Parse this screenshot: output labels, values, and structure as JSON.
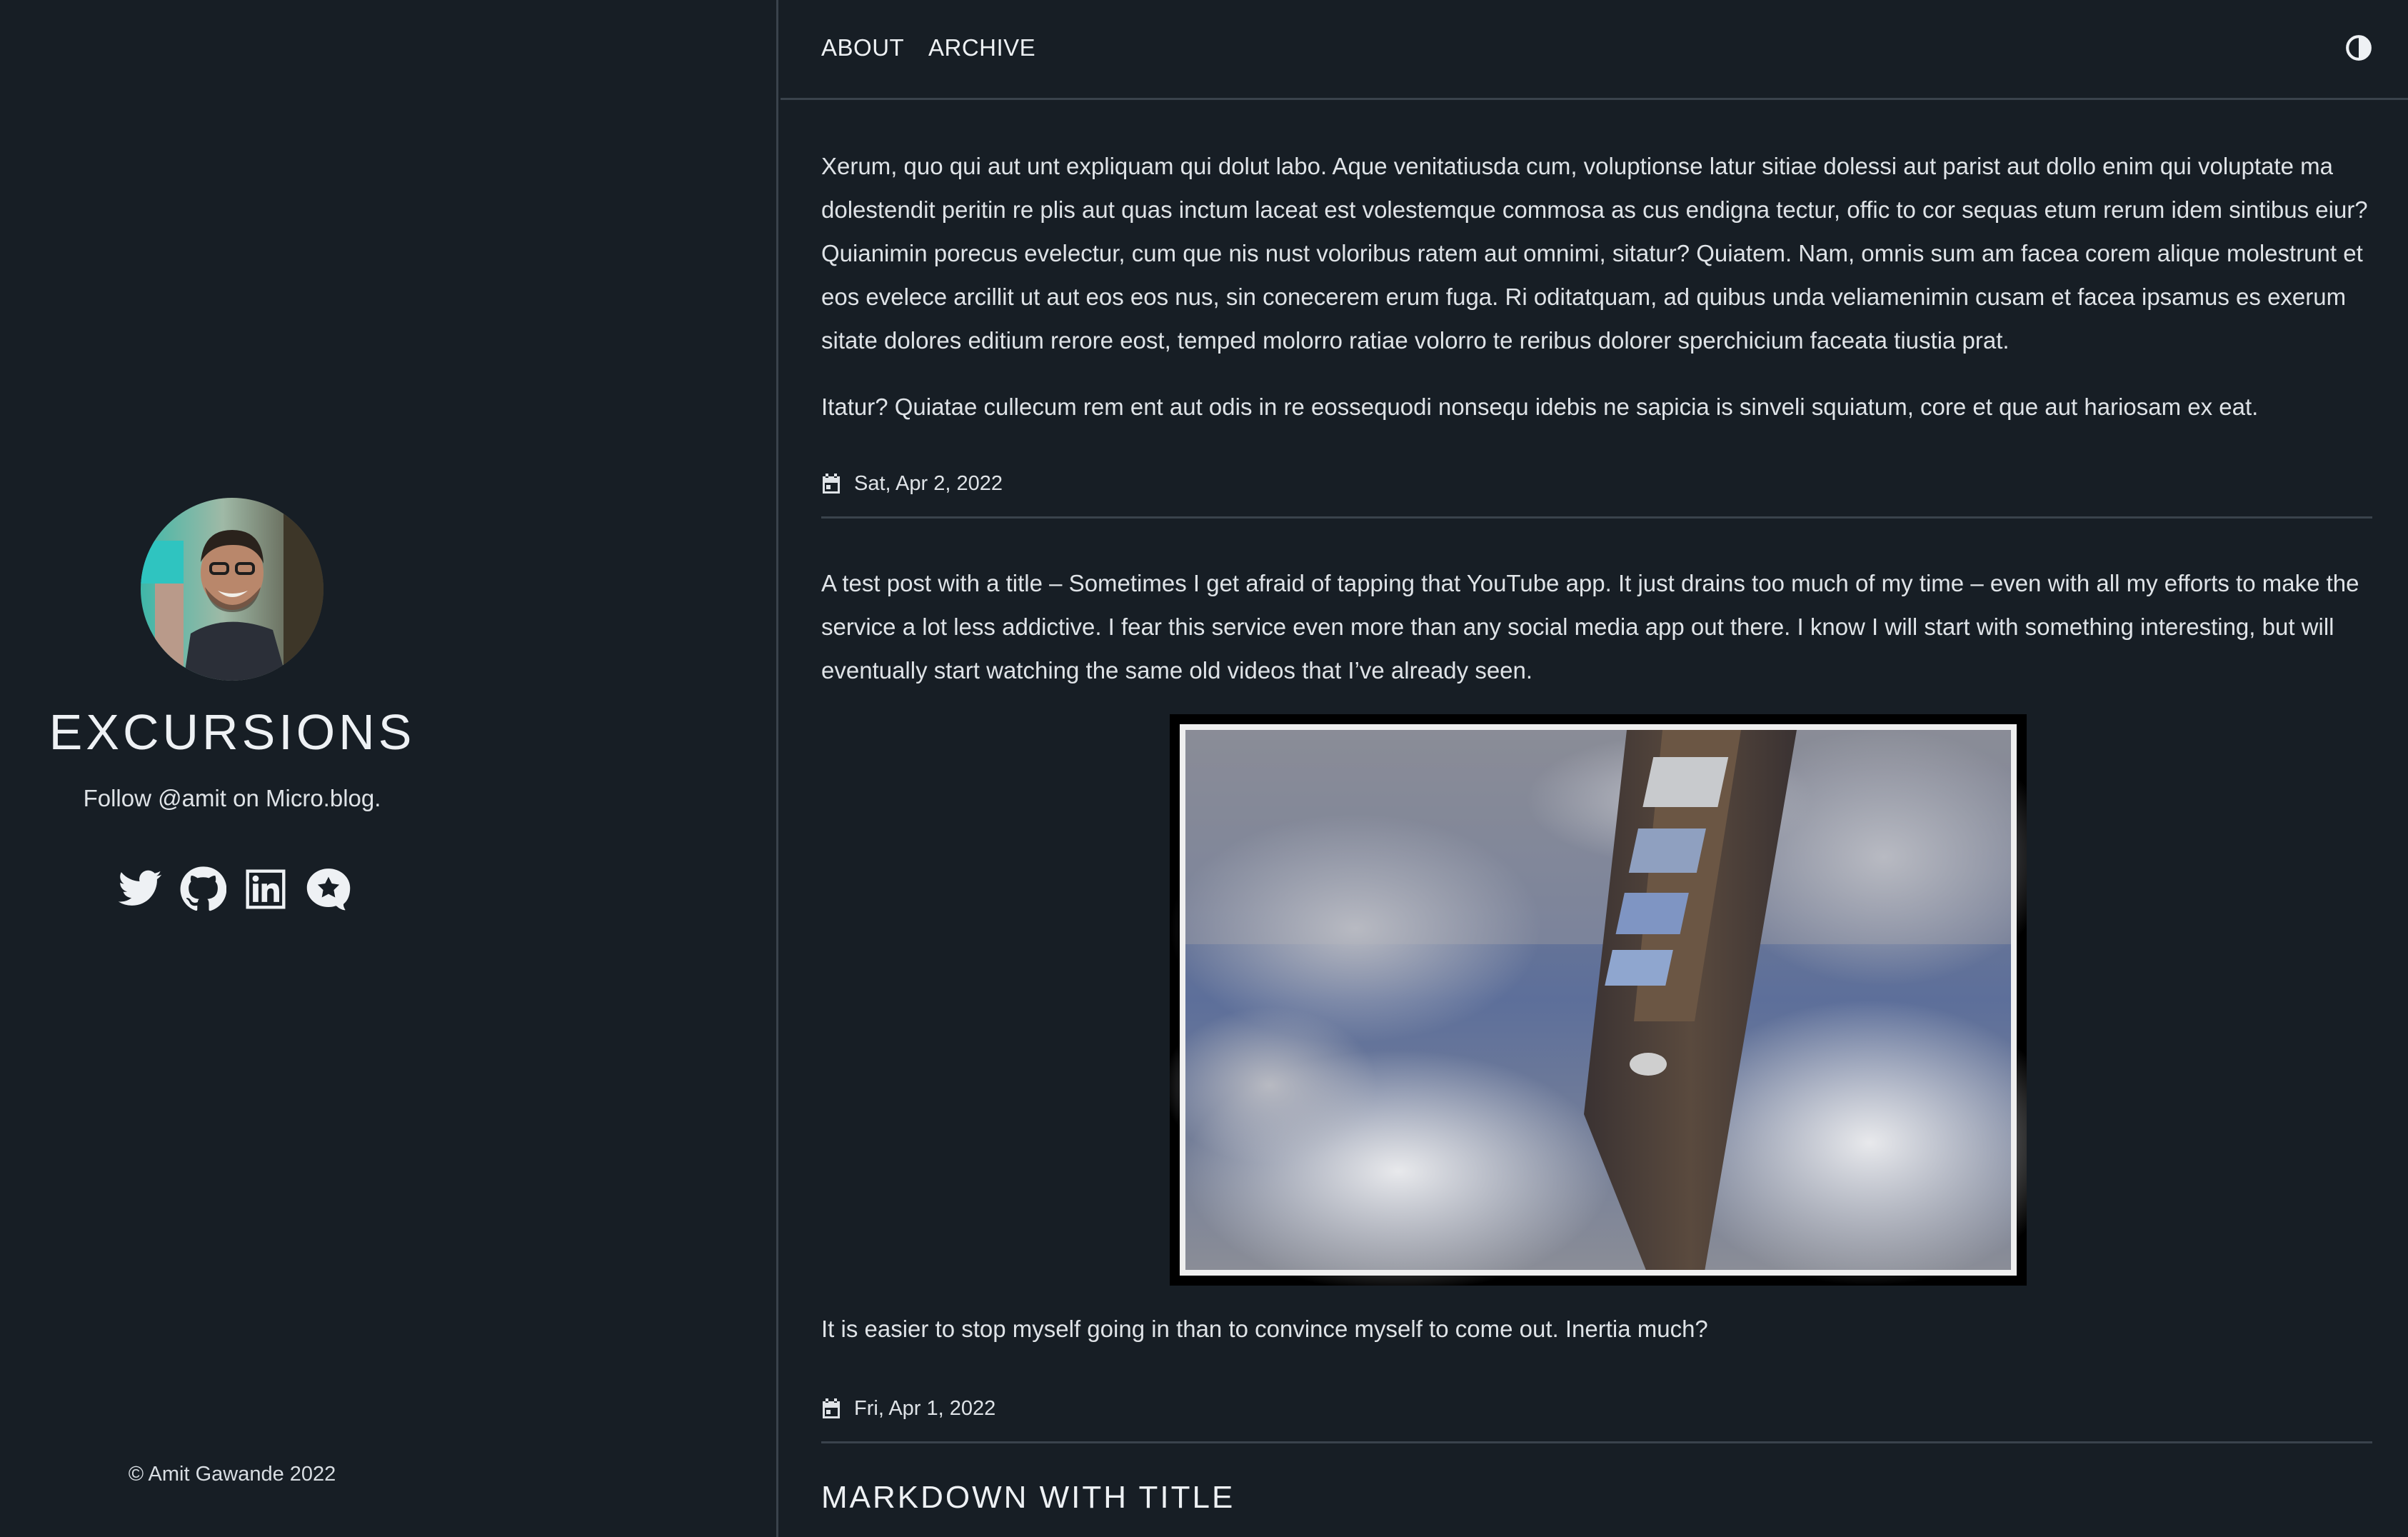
{
  "sidebar": {
    "site_title": "EXCURSIONS",
    "tagline": "Follow @amit on Micro.blog.",
    "social": [
      {
        "icon": "twitter-icon"
      },
      {
        "icon": "github-icon"
      },
      {
        "icon": "linkedin-icon"
      },
      {
        "icon": "microblog-icon"
      }
    ],
    "copyright": "© Amit Gawande 2022"
  },
  "nav": {
    "about": "ABOUT",
    "archive": "ARCHIVE",
    "theme_toggle_icon": "contrast-icon"
  },
  "posts": [
    {
      "paragraphs": [
        "Xerum, quo qui aut unt expliquam qui dolut labo. Aque venitatiusda cum, voluptionse latur sitiae dolessi aut parist aut dollo enim qui voluptate ma dolestendit peritin re plis aut quas inctum laceat est volestemque commosa as cus endigna tectur, offic to cor sequas etum rerum idem sintibus eiur? Quianimin porecus evelectur, cum que nis nust voloribus ratem aut omnimi, sitatur? Quiatem. Nam, omnis sum am facea corem alique molestrunt et eos evelece arcillit ut aut eos eos nus, sin conecerem erum fuga. Ri oditatquam, ad quibus unda veliamenimin cusam et facea ipsamus es exerum sitate dolores editium rerore eost, temped molorro ratiae volorro te reribus dolorer sperchicium faceata tiustia prat.",
        "Itatur? Quiatae cullecum rem ent aut odis in re eossequodi nonsequ idebis ne sapicia is sinveli squiatum, core et que aut hariosam ex eat."
      ],
      "date": "Sat, Apr 2, 2022"
    },
    {
      "paragraphs": [
        "A test post with a title – Sometimes I get afraid of tapping that YouTube app. It just drains too much of my time – even with all my efforts to make the service a lot less addictive. I fear this service even more than any social media app out there. I know I will start with something interesting, but will eventually start watching the same old videos that I’ve already seen.",
        "It is easier to stop myself going in than to convince myself to come out. Inertia much?"
      ],
      "date": "Fri, Apr 1, 2022"
    },
    {
      "title": "MARKDOWN WITH TITLE"
    }
  ]
}
